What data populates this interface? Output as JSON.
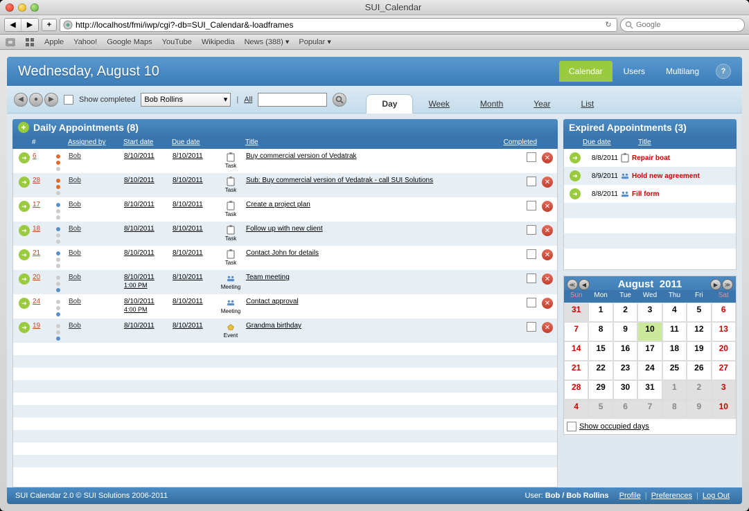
{
  "window": {
    "title": "SUI_Calendar"
  },
  "browser": {
    "url": "http://localhost/fmi/iwp/cgi?-db=SUI_Calendar&-loadframes",
    "search_placeholder": "Google",
    "bookmarks": [
      "Apple",
      "Yahoo!",
      "Google Maps",
      "YouTube",
      "Wikipedia",
      "News (388)",
      "Popular"
    ]
  },
  "header": {
    "date_title": "Wednesday, August 10",
    "tabs": [
      {
        "label": "Calendar",
        "active": true
      },
      {
        "label": "Users",
        "active": false
      },
      {
        "label": "Multilang",
        "active": false
      }
    ]
  },
  "subheader": {
    "show_completed": "Show completed",
    "user": "Bob Rollins",
    "all": "All",
    "views": [
      {
        "label": "Day",
        "active": true
      },
      {
        "label": "Week",
        "active": false
      },
      {
        "label": "Month",
        "active": false
      },
      {
        "label": "Year",
        "active": false
      },
      {
        "label": "List",
        "active": false
      }
    ]
  },
  "daily": {
    "title": "Daily Appointments (8)",
    "columns": {
      "num": "#",
      "assigned": "Assigned by",
      "start": "Start date",
      "due": "Due date",
      "title": "Title",
      "completed": "Completed"
    },
    "rows": [
      {
        "id": "6",
        "pri": "high",
        "assigned": "Bob",
        "start": "8/10/2011",
        "start_time": "",
        "due": "8/10/2011",
        "type": "Task",
        "title": "Buy commercial version of Vedatrak"
      },
      {
        "id": "28",
        "pri": "high",
        "assigned": "Bob",
        "start": "8/10/2011",
        "start_time": "",
        "due": "8/10/2011",
        "type": "Task",
        "title": "Sub: Buy commercial version of Vedatrak - call SUI Solutions"
      },
      {
        "id": "17",
        "pri": "med",
        "assigned": "Bob",
        "start": "8/10/2011",
        "start_time": "",
        "due": "8/10/2011",
        "type": "Task",
        "title": "Create a project plan"
      },
      {
        "id": "18",
        "pri": "med",
        "assigned": "Bob",
        "start": "8/10/2011",
        "start_time": "",
        "due": "8/10/2011",
        "type": "Task",
        "title": "Follow up with new client"
      },
      {
        "id": "21",
        "pri": "med",
        "assigned": "Bob",
        "start": "8/10/2011",
        "start_time": "",
        "due": "8/10/2011",
        "type": "Task",
        "title": "Contact John for details"
      },
      {
        "id": "20",
        "pri": "low",
        "assigned": "Bob",
        "start": "8/10/2011",
        "start_time": "1:00 PM",
        "due": "8/10/2011",
        "type": "Meeting",
        "title": "Team meeting"
      },
      {
        "id": "24",
        "pri": "low",
        "assigned": "Bob",
        "start": "8/10/2011",
        "start_time": "4:00 PM",
        "due": "8/10/2011",
        "type": "Meeting",
        "title": "Contact approval"
      },
      {
        "id": "19",
        "pri": "low",
        "assigned": "Bob",
        "start": "8/10/2011",
        "start_time": "",
        "due": "8/10/2011",
        "type": "Event",
        "title": "Grandma birthday"
      }
    ]
  },
  "expired": {
    "title": "Expired Appointments (3)",
    "columns": {
      "due": "Due date",
      "title": "Title"
    },
    "rows": [
      {
        "due": "8/8/2011",
        "type": "Task",
        "title": "Repair boat"
      },
      {
        "due": "8/9/2011",
        "type": "Meeting",
        "title": "Hold new agreement"
      },
      {
        "due": "8/8/2011",
        "type": "Meeting",
        "title": "Fill form"
      }
    ]
  },
  "minical": {
    "month": "August",
    "year": "2011",
    "dow": [
      "Sun",
      "Mon",
      "Tue",
      "Wed",
      "Thu",
      "Fri",
      "Sat"
    ],
    "weeks": [
      [
        {
          "d": "31",
          "other": true,
          "wk": true
        },
        {
          "d": "1"
        },
        {
          "d": "2"
        },
        {
          "d": "3"
        },
        {
          "d": "4"
        },
        {
          "d": "5"
        },
        {
          "d": "6",
          "wk": true
        }
      ],
      [
        {
          "d": "7",
          "wk": true
        },
        {
          "d": "8"
        },
        {
          "d": "9"
        },
        {
          "d": "10",
          "today": true
        },
        {
          "d": "11"
        },
        {
          "d": "12"
        },
        {
          "d": "13",
          "wk": true
        }
      ],
      [
        {
          "d": "14",
          "wk": true
        },
        {
          "d": "15"
        },
        {
          "d": "16"
        },
        {
          "d": "17"
        },
        {
          "d": "18"
        },
        {
          "d": "19"
        },
        {
          "d": "20",
          "wk": true
        }
      ],
      [
        {
          "d": "21",
          "wk": true
        },
        {
          "d": "22"
        },
        {
          "d": "23"
        },
        {
          "d": "24"
        },
        {
          "d": "25"
        },
        {
          "d": "26"
        },
        {
          "d": "27",
          "wk": true
        }
      ],
      [
        {
          "d": "28",
          "wk": true
        },
        {
          "d": "29"
        },
        {
          "d": "30"
        },
        {
          "d": "31"
        },
        {
          "d": "1",
          "other": true
        },
        {
          "d": "2",
          "other": true
        },
        {
          "d": "3",
          "other": true,
          "wk": true
        }
      ],
      [
        {
          "d": "4",
          "other": true,
          "wk": true
        },
        {
          "d": "5",
          "other": true
        },
        {
          "d": "6",
          "other": true
        },
        {
          "d": "7",
          "other": true
        },
        {
          "d": "8",
          "other": true
        },
        {
          "d": "9",
          "other": true
        },
        {
          "d": "10",
          "other": true,
          "wk": true
        }
      ]
    ],
    "show_occupied": "Show occupied days"
  },
  "footer": {
    "copyright": "SUI Calendar 2.0 © SUI Solutions 2006-2011",
    "user_label": "User:",
    "user": "Bob / Bob Rollins",
    "links": {
      "profile": "Profile",
      "prefs": "Preferences",
      "logout": "Log Out"
    }
  }
}
